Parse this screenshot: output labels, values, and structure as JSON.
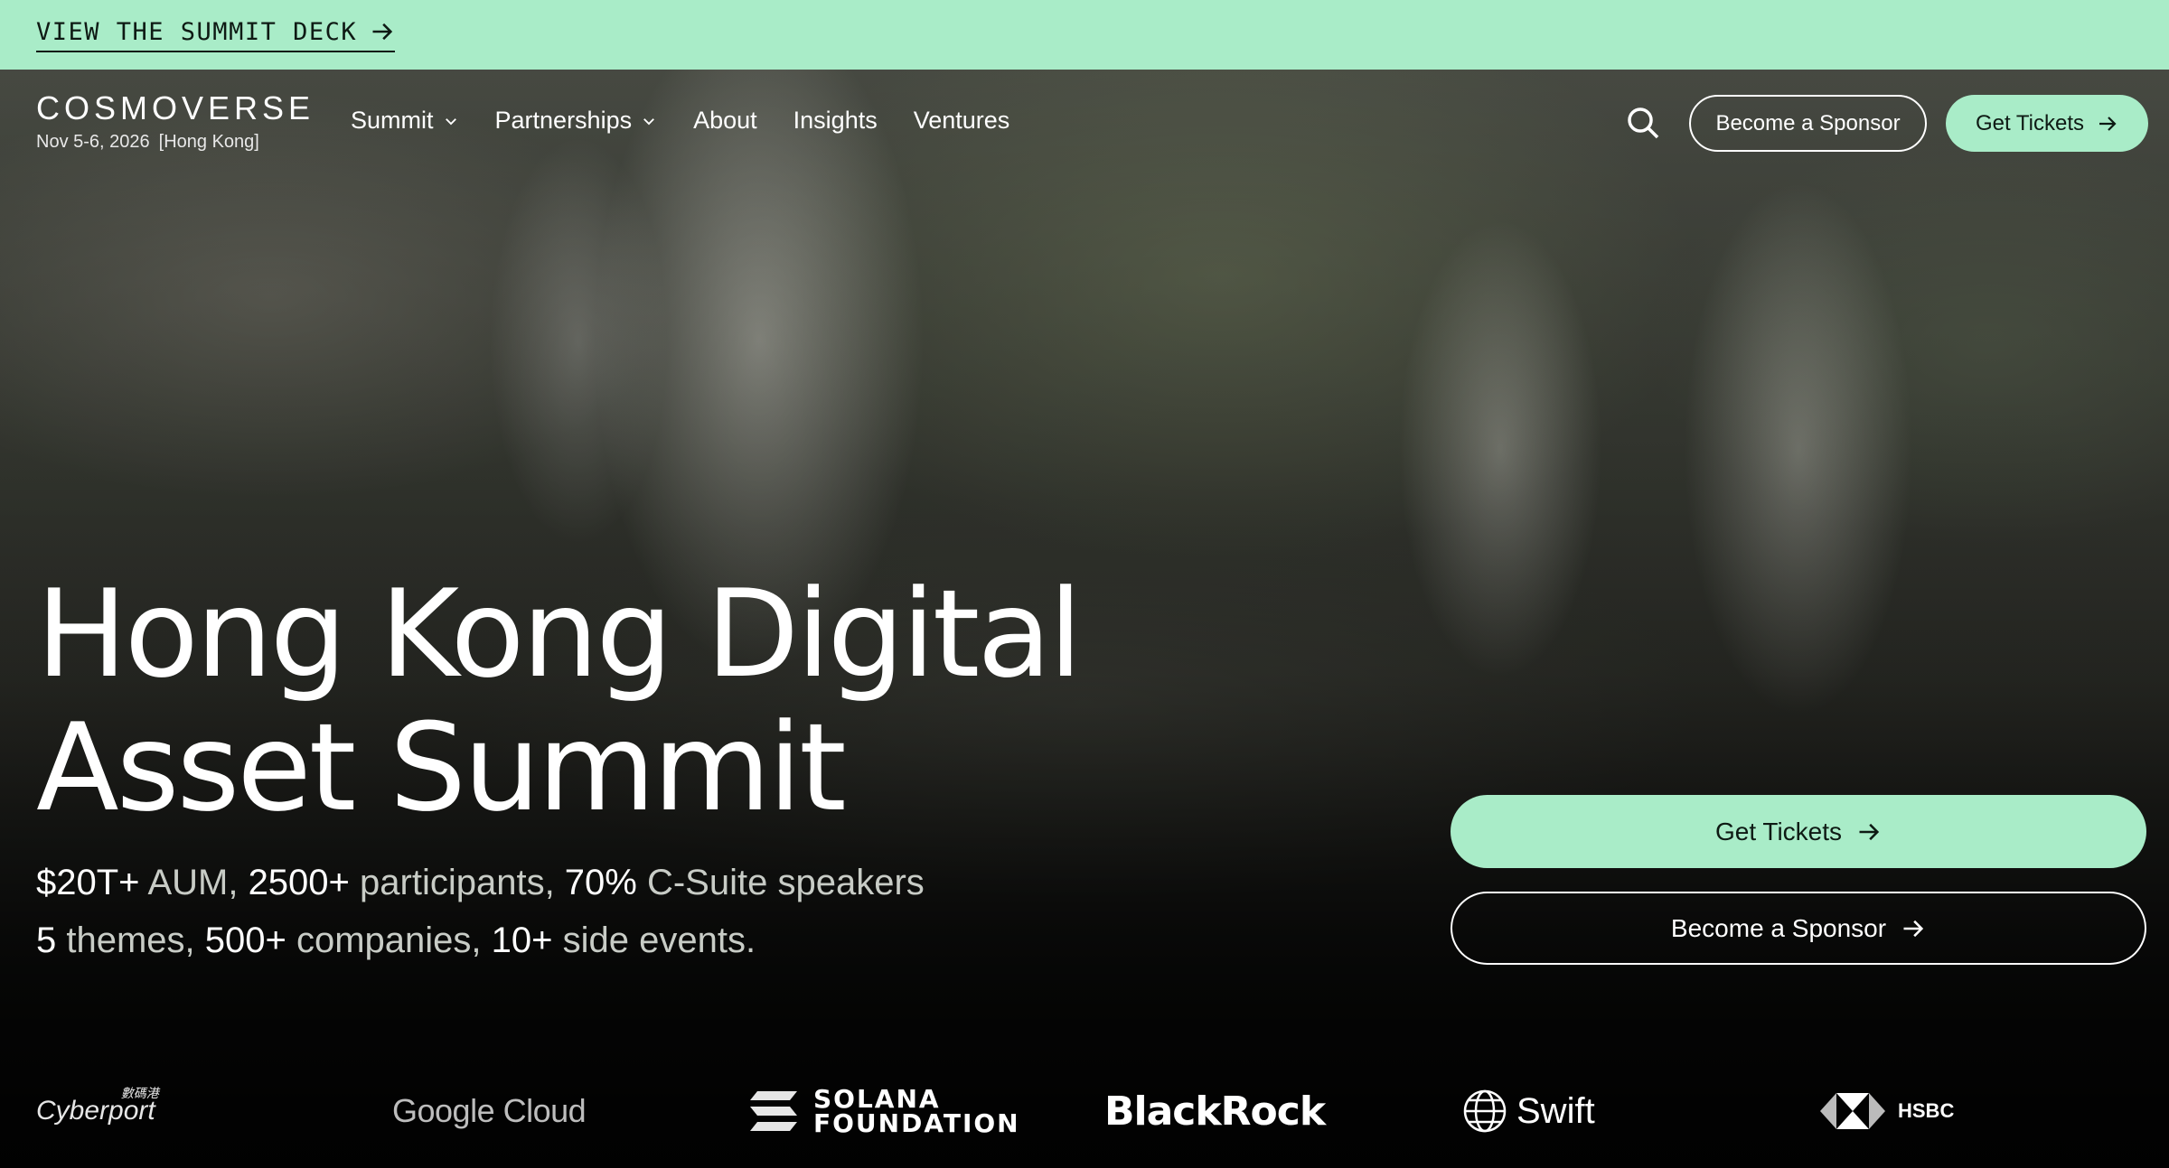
{
  "topbar": {
    "link_label": "VIEW THE SUMMIT DECK"
  },
  "brand": {
    "name": "COSMOVERSE",
    "date": "Nov 5-6, 2026",
    "location": "[Hong Kong]"
  },
  "nav": {
    "items": [
      {
        "label": "Summit",
        "dropdown": true
      },
      {
        "label": "Partnerships",
        "dropdown": true
      },
      {
        "label": "About"
      },
      {
        "label": "Insights"
      },
      {
        "label": "Ventures"
      }
    ],
    "sponsor_label": "Become a Sponsor",
    "tickets_label": "Get Tickets"
  },
  "hero": {
    "title_line1": "Hong Kong Digital",
    "title_line2": "Asset Summit",
    "stats": {
      "l1_a": "$20T+",
      "l1_b": " AUM, ",
      "l1_c": "2500+",
      "l1_d": " participants, ",
      "l1_e": "70%",
      "l1_f": " C-Suite speakers",
      "l2_a": "5",
      "l2_b": " themes, ",
      "l2_c": "500+",
      "l2_d": " companies, ",
      "l2_e": "10+",
      "l2_f": " side events."
    },
    "cta_tickets": "Get Tickets",
    "cta_sponsor": "Become a Sponsor"
  },
  "partners": {
    "cyberport": "Cyberport",
    "cyberport_cn": "數碼港",
    "google": "Google Cloud",
    "solana_1": "SOLANA",
    "solana_2": "FOUNDATION",
    "blackrock": "BlackRock",
    "swift": "Swift",
    "hsbc": "HSBC"
  },
  "colors": {
    "accent": "#a9ecc8",
    "text_dark": "#0e1a14"
  },
  "icons": [
    "arrow-right-icon",
    "chevron-down-icon",
    "search-icon",
    "globe-icon"
  ]
}
